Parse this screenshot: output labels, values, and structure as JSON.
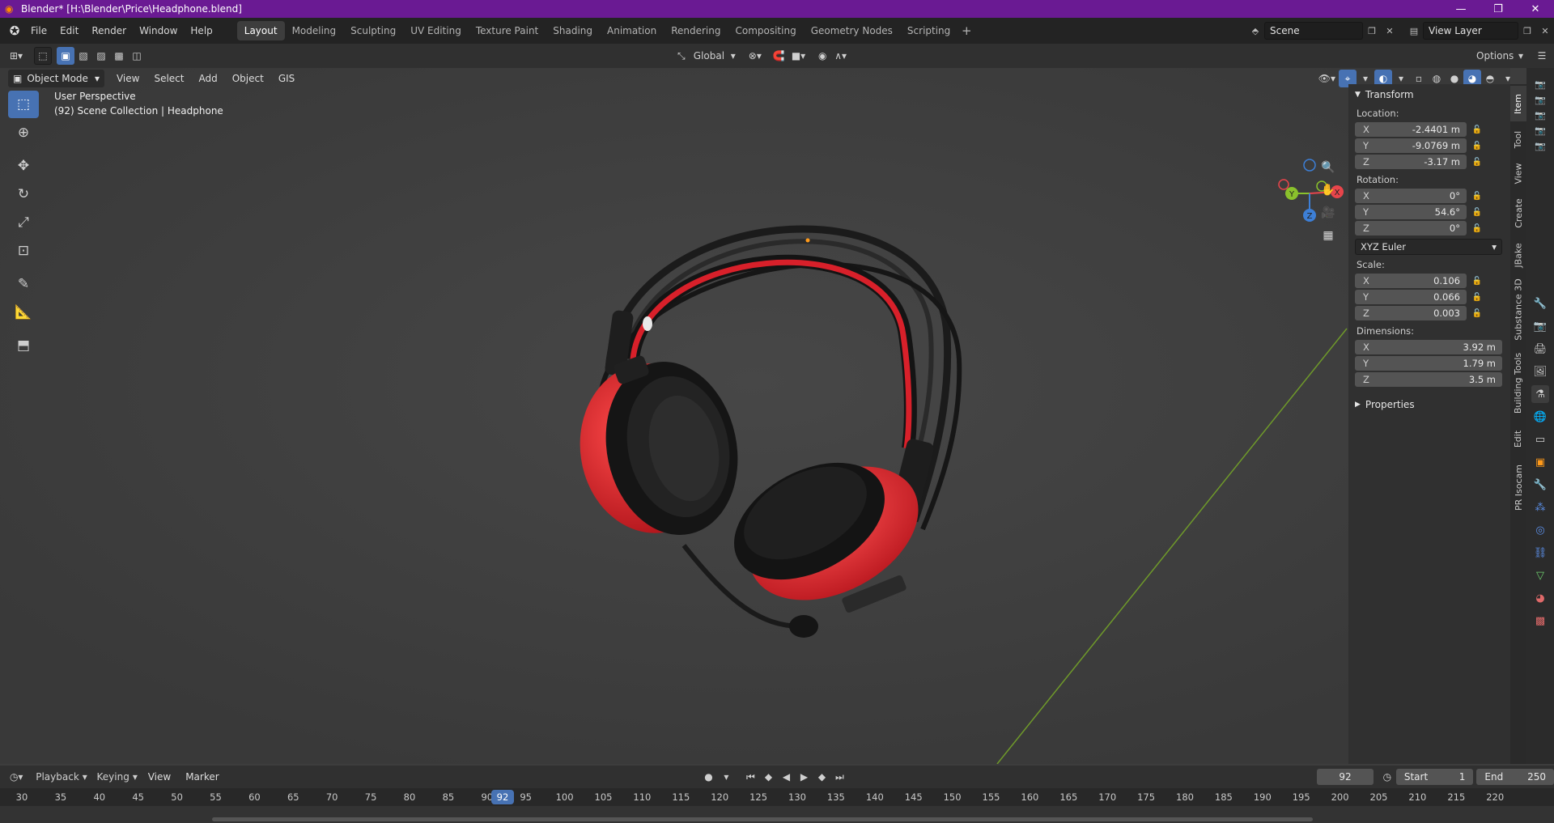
{
  "window": {
    "title": "Blender* [H:\\Blender\\Price\\Headphone.blend]",
    "controls": [
      "—",
      "❐",
      "✕"
    ]
  },
  "menu": [
    "File",
    "Edit",
    "Render",
    "Window",
    "Help"
  ],
  "workspaces": [
    "Layout",
    "Modeling",
    "Sculpting",
    "UV Editing",
    "Texture Paint",
    "Shading",
    "Animation",
    "Rendering",
    "Compositing",
    "Geometry Nodes",
    "Scripting"
  ],
  "active_workspace": "Layout",
  "scene": {
    "name": "Scene",
    "view_layer": "View Layer"
  },
  "header": {
    "transform_orientation": "Global",
    "options": "Options"
  },
  "viewport": {
    "mode": "Object Mode",
    "menus": [
      "View",
      "Select",
      "Add",
      "Object",
      "GIS"
    ],
    "info_line1": "User Perspective",
    "info_line2": "(92) Scene Collection | Headphone"
  },
  "npanel": {
    "transform_title": "Transform",
    "location_label": "Location:",
    "location": {
      "x": "-2.4401 m",
      "y": "-9.0769 m",
      "z": "-3.17 m"
    },
    "rotation_label": "Rotation:",
    "rotation": {
      "x": "0°",
      "y": "54.6°",
      "z": "0°"
    },
    "rotation_mode": "XYZ Euler",
    "scale_label": "Scale:",
    "scale": {
      "x": "0.106",
      "y": "0.066",
      "z": "0.003"
    },
    "dimensions_label": "Dimensions:",
    "dimensions": {
      "x": "3.92 m",
      "y": "1.79 m",
      "z": "3.5 m"
    },
    "properties_title": "Properties",
    "axes": {
      "x": "X",
      "y": "Y",
      "z": "Z"
    }
  },
  "side_tabs": [
    "Item",
    "Tool",
    "View",
    "Create",
    "JBake",
    "Substance 3D",
    "Building Tools",
    "Edit",
    "PR Isocam"
  ],
  "gizmo": {
    "x": "X",
    "y": "Y",
    "z": "Z"
  },
  "timeline": {
    "menus": [
      "Playback",
      "Keying",
      "View",
      "Marker"
    ],
    "current_frame": "92",
    "start_label": "Start",
    "start": "1",
    "end_label": "End",
    "end": "250",
    "ticks": [
      "30",
      "35",
      "40",
      "45",
      "50",
      "55",
      "60",
      "65",
      "70",
      "75",
      "80",
      "85",
      "90",
      "95",
      "100",
      "105",
      "110",
      "115",
      "120",
      "125",
      "130",
      "135",
      "140",
      "145",
      "150",
      "155",
      "160",
      "165",
      "170",
      "175",
      "180",
      "185",
      "190",
      "195",
      "200",
      "205",
      "210",
      "215",
      "220"
    ]
  },
  "colors": {
    "titlebar": "#6a1a93",
    "accent": "#4772b3",
    "headphone_red": "#d8202a",
    "x_axis": "#e8454b",
    "y_axis": "#8ac12c",
    "z_axis": "#3d7fd6"
  }
}
